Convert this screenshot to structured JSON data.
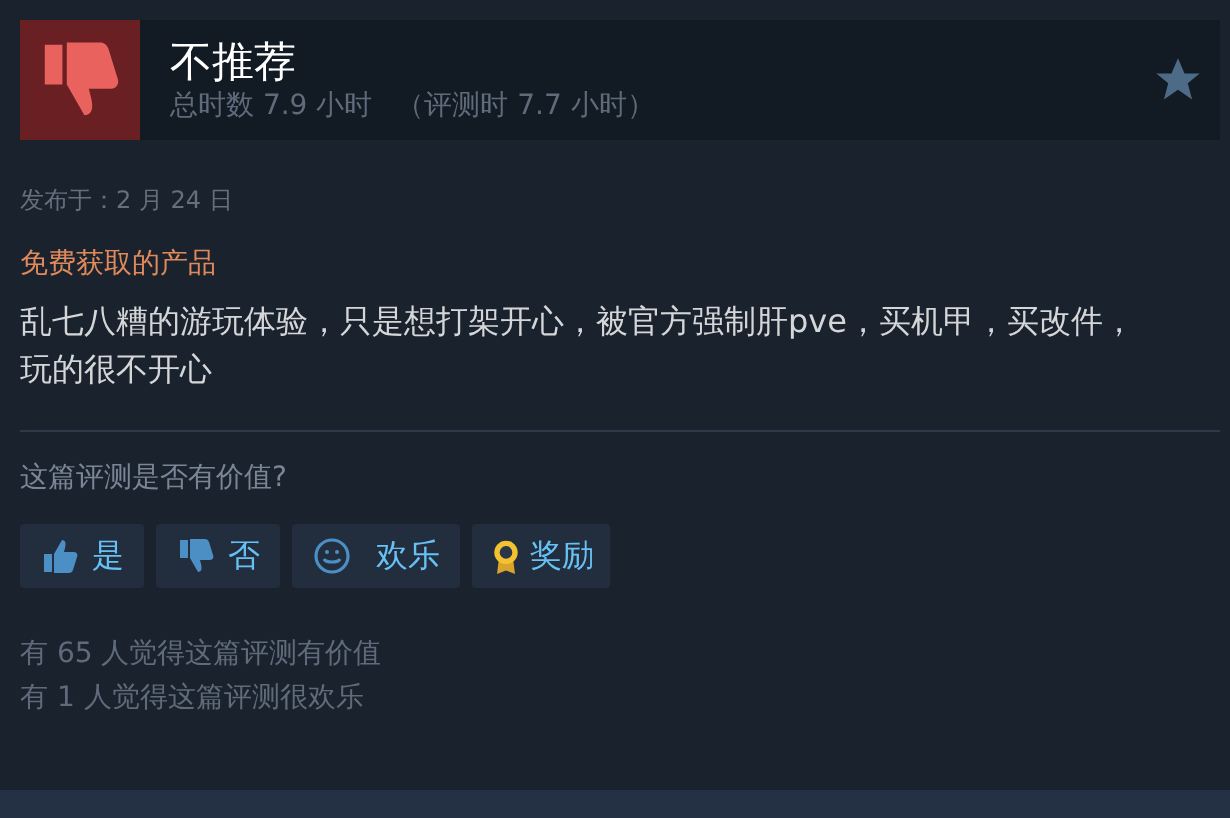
{
  "header": {
    "verdict": "不推荐",
    "recommended": false,
    "hours": "总时数 7.9 小时",
    "review_hours": "（评测时 7.7 小时）"
  },
  "posted": "发布于：2 月 24 日",
  "free_label": "免费获取的产品",
  "review_text": "乱七八糟的游玩体验，只是想打架开心，被官方强制肝pve，买机甲，买改件，玩的很不开心",
  "helpful_prompt": "这篇评测是否有价值?",
  "buttons": [
    {
      "kind": "yes",
      "label": "是"
    },
    {
      "kind": "no",
      "label": "否"
    },
    {
      "kind": "funny",
      "label": "欢乐"
    },
    {
      "kind": "award",
      "label": "奖励"
    }
  ],
  "stats": [
    "有 65 人觉得这篇评测有价值",
    "有 1 人觉得这篇评测很欢乐"
  ]
}
